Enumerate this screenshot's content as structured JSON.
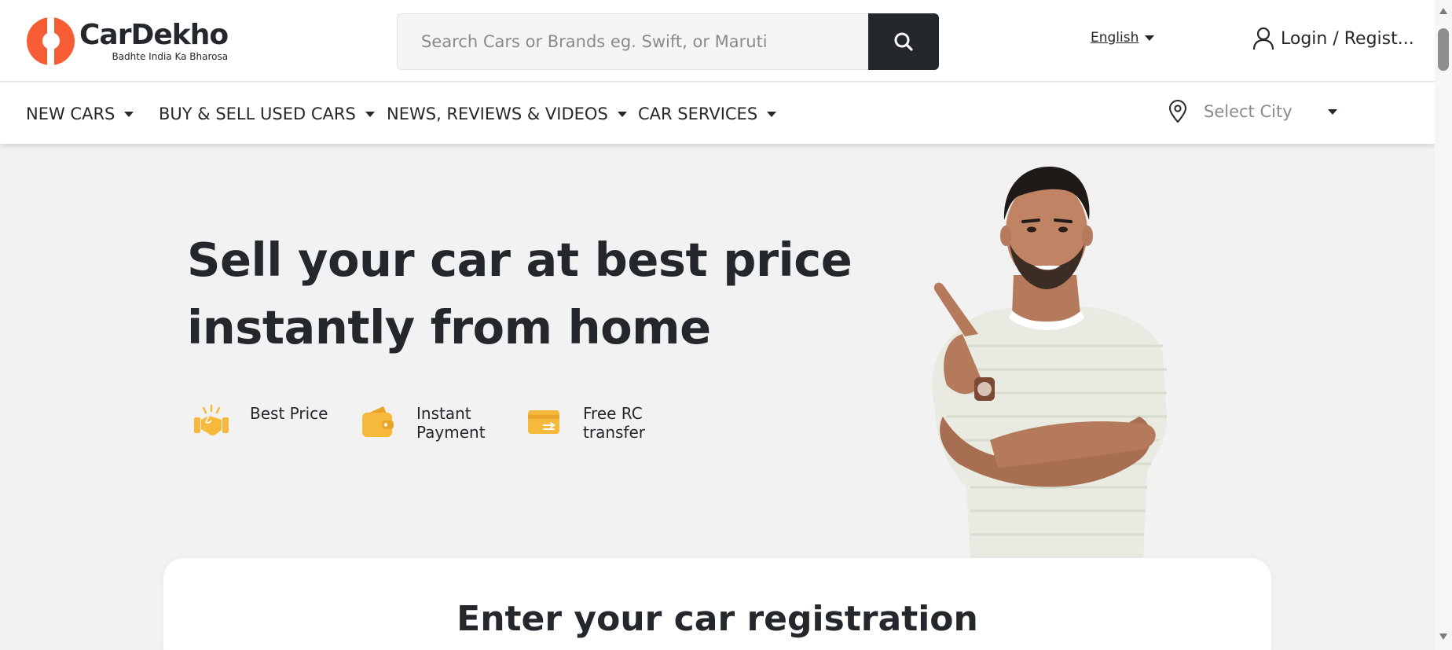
{
  "header": {
    "logo_name": "CarDekho",
    "logo_tagline": "Badhte India Ka Bharosa",
    "search_placeholder": "Search Cars or Brands eg. Swift, or Maruti",
    "language": "English",
    "login_label": "Login / Regist..."
  },
  "nav": {
    "items": [
      {
        "label": "NEW CARS"
      },
      {
        "label": "BUY & SELL USED CARS"
      },
      {
        "label": "NEWS, REVIEWS & VIDEOS"
      },
      {
        "label": "CAR SERVICES"
      }
    ],
    "city_placeholder": "Select City"
  },
  "hero": {
    "title_line1": "Sell your car at best price",
    "title_line2": "instantly from home",
    "features": [
      {
        "label": "Best Price",
        "icon": "handshake-icon"
      },
      {
        "label": "Instant Payment",
        "icon": "wallet-icon"
      },
      {
        "label": "Free RC transfer",
        "icon": "rc-card-icon"
      }
    ]
  },
  "card": {
    "title": "Enter your car registration"
  },
  "colors": {
    "brand": "#f75d34",
    "dark": "#24272c",
    "feature_icon": "#f6b93b",
    "page_bg": "#f2f2f2"
  }
}
